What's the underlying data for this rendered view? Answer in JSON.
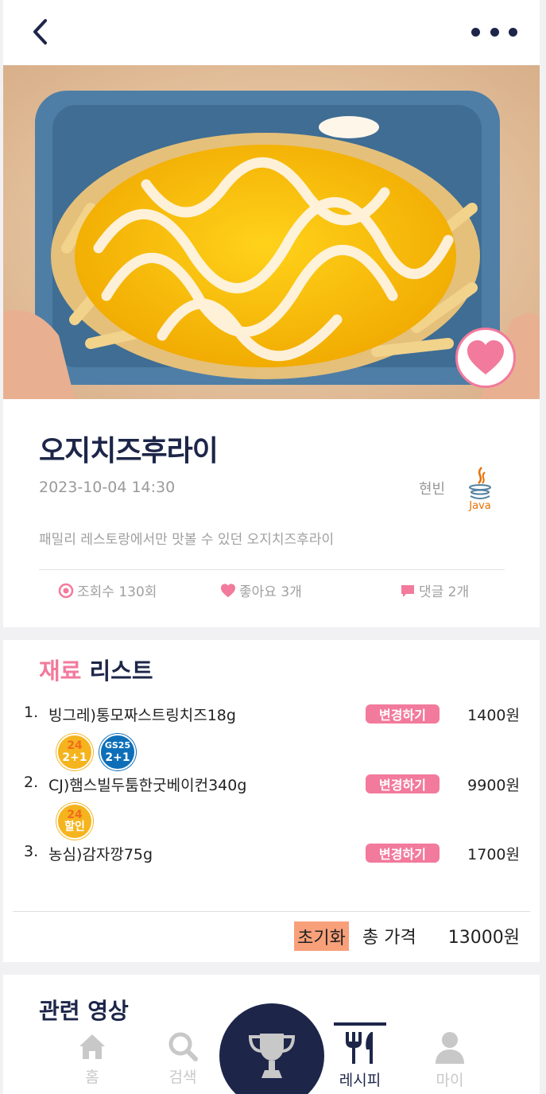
{
  "header": {
    "back_icon": "chevron-left-icon",
    "more_icon": "more-dots-icon"
  },
  "recipe": {
    "title": "오지치즈후라이",
    "date": "2023-10-04 14:30",
    "author": "현빈",
    "author_logo_text": "Java",
    "description": "패밀리 레스토랑에서만 맛볼 수 있던 오지치즈후라이",
    "views": "조회수 130회",
    "likes": "좋아요 3개",
    "comments": "댓글 2개"
  },
  "ingredients": {
    "title_accent": "재료",
    "title_rest": " 리스트",
    "change_label": "변경하기",
    "items": [
      {
        "num": "1.",
        "name": "빙그레)통모짜스트링치즈18g",
        "price": "1400원",
        "badges": [
          {
            "store": "emart24",
            "top": "24",
            "bottom": "2+1"
          },
          {
            "store": "GS25",
            "top": "GS25",
            "bottom": "2+1"
          }
        ]
      },
      {
        "num": "2.",
        "name": "CJ)햄스빌두툼한굿베이컨340g",
        "price": "9900원",
        "badges": [
          {
            "store": "emart24",
            "top": "24",
            "bottom": "할인"
          }
        ]
      },
      {
        "num": "3.",
        "name": "농심)감자깡75g",
        "price": "1700원",
        "badges": []
      }
    ],
    "reset_label": "초기화",
    "total_label": "총 가격",
    "total_value": "13000원"
  },
  "video": {
    "title": "관련 영상"
  },
  "nav": {
    "items": [
      {
        "label": "홈",
        "icon": "home-icon"
      },
      {
        "label": "검색",
        "icon": "search-icon"
      },
      {
        "label": "",
        "icon": "trophy-icon"
      },
      {
        "label": "레시피",
        "icon": "fork-knife-icon",
        "active": true
      },
      {
        "label": "마이",
        "icon": "user-icon"
      }
    ]
  },
  "colors": {
    "navy": "#1d2649",
    "pink": "#f27a9c",
    "reset": "#f8a07a"
  }
}
